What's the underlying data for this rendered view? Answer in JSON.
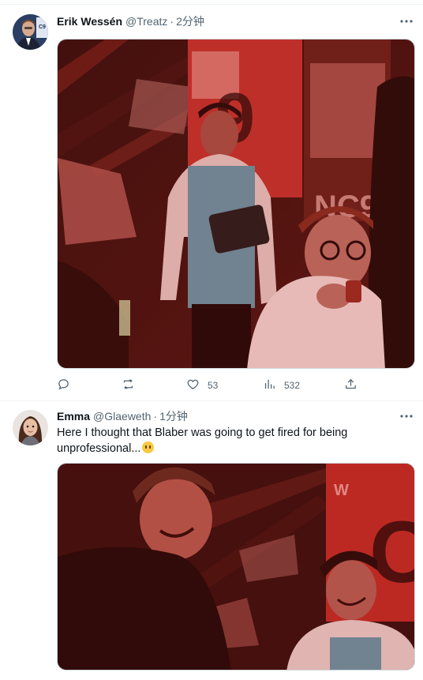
{
  "tweets": [
    {
      "name": "Erik Wessén",
      "handle": "@Treatz",
      "separator": "·",
      "time": "2分钟",
      "text": "",
      "actions": {
        "reply_count": "",
        "retweet_count": "",
        "like_count": "53",
        "view_count": "532"
      }
    },
    {
      "name": "Emma",
      "handle": "@Glaeweth",
      "separator": "·",
      "time": "1分钟",
      "text": "Here I thought that Blaber was going to get fired for being unprofessional..."
    }
  ],
  "icons": {
    "more": "more-horizontal-icon",
    "reply": "reply-icon",
    "retweet": "retweet-icon",
    "like": "heart-icon",
    "views": "views-chart-icon",
    "share": "share-icon",
    "emoji": "face-without-mouth-emoji"
  },
  "colors": {
    "text_primary": "#0f1419",
    "text_secondary": "#536471",
    "divider": "#eff3f4",
    "image_tint": "#6b1a18"
  }
}
